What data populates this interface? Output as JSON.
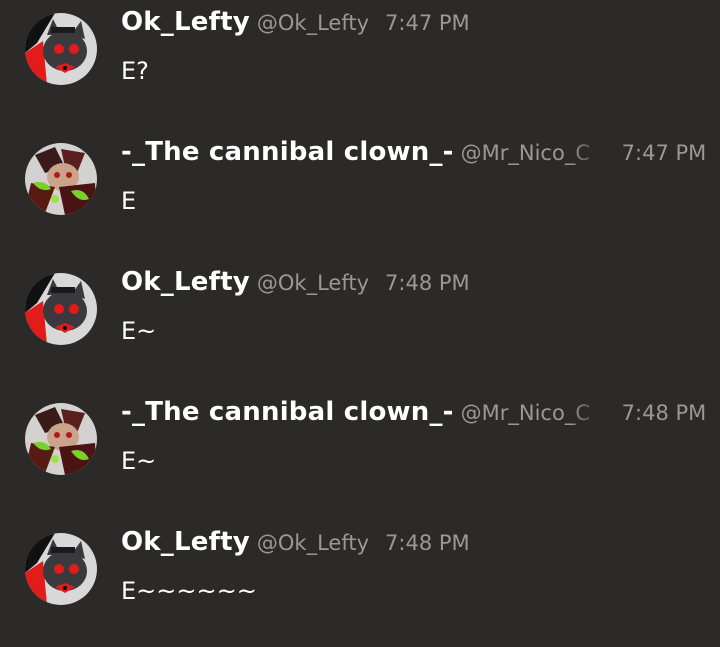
{
  "messages": [
    {
      "username": "Ok_Lefty",
      "handle": "@Ok_Lefty",
      "time": "7:47 PM",
      "text": "E?",
      "avatar": "lefty-avatar"
    },
    {
      "username": "-_The cannibal clown_-",
      "handle": "@Mr_Nico_C",
      "time": "7:47 PM",
      "text": "E",
      "avatar": "clown-avatar"
    },
    {
      "username": "Ok_Lefty",
      "handle": "@Ok_Lefty",
      "time": "7:48 PM",
      "text": "E~",
      "avatar": "lefty-avatar"
    },
    {
      "username": "-_The cannibal clown_-",
      "handle": "@Mr_Nico_C",
      "time": "7:48 PM",
      "text": "E~",
      "avatar": "clown-avatar"
    },
    {
      "username": "Ok_Lefty",
      "handle": "@Ok_Lefty",
      "time": "7:48 PM",
      "text": "E~~~~~~",
      "avatar": "lefty-avatar"
    }
  ],
  "colors": {
    "background": "#2c2a28",
    "username": "#ffffff",
    "meta": "#9a9896",
    "text": "#ffffff"
  }
}
